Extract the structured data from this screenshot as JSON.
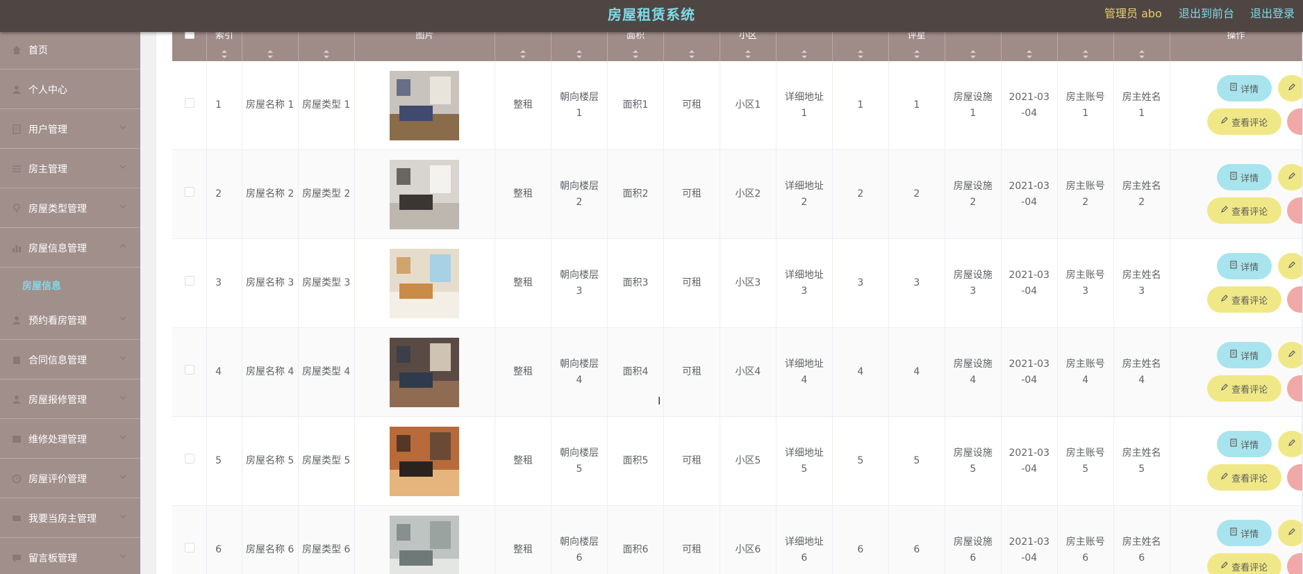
{
  "header": {
    "title": "房屋租赁系统",
    "admin": "管理员 abo",
    "back_to_front": "退出到前台",
    "logout": "退出登录"
  },
  "sidebar": {
    "items": [
      {
        "label": "首页",
        "icon": "home-icon"
      },
      {
        "label": "个人中心",
        "icon": "user-icon"
      },
      {
        "label": "用户管理",
        "icon": "document-icon"
      },
      {
        "label": "房主管理",
        "icon": "list-icon"
      },
      {
        "label": "房屋类型管理",
        "icon": "pin-icon"
      },
      {
        "label": "房屋信息管理",
        "icon": "chart-icon",
        "expanded": true
      },
      {
        "label": "预约看房管理",
        "icon": "user-icon"
      },
      {
        "label": "合同信息管理",
        "icon": "building-icon"
      },
      {
        "label": "房屋报修管理",
        "icon": "user-icon"
      },
      {
        "label": "维修处理管理",
        "icon": "grid-icon"
      },
      {
        "label": "房屋评价管理",
        "icon": "clock-icon"
      },
      {
        "label": "我要当房主管理",
        "icon": "keyboard-icon"
      },
      {
        "label": "留言板管理",
        "icon": "message-icon"
      }
    ],
    "submenu": {
      "label": "房屋信息"
    }
  },
  "table": {
    "header_labels": [
      "",
      "索引",
      "",
      "",
      "图片",
      "",
      "",
      "面积",
      "",
      "小区",
      "",
      "",
      "评星",
      "",
      "",
      "",
      "",
      "操作"
    ],
    "rows": [
      {
        "index": "1",
        "name": "房屋名称\n1",
        "type": "房屋类型\n1",
        "rent": "整租",
        "orient": "朝向楼层\n1",
        "area": "面积1",
        "status": "可租",
        "estate": "小区1",
        "addr": "详细地址\n1",
        "c11": "1",
        "c12": "1",
        "facility": "房屋设施\n1",
        "date": "2021-03\n-04",
        "account": "房主账号\n1",
        "owner": "房主姓名\n1"
      },
      {
        "index": "2",
        "name": "房屋名称\n2",
        "type": "房屋类型\n2",
        "rent": "整租",
        "orient": "朝向楼层\n2",
        "area": "面积2",
        "status": "可租",
        "estate": "小区2",
        "addr": "详细地址\n2",
        "c11": "2",
        "c12": "2",
        "facility": "房屋设施\n2",
        "date": "2021-03\n-04",
        "account": "房主账号\n2",
        "owner": "房主姓名\n2"
      },
      {
        "index": "3",
        "name": "房屋名称\n3",
        "type": "房屋类型\n3",
        "rent": "整租",
        "orient": "朝向楼层\n3",
        "area": "面积3",
        "status": "可租",
        "estate": "小区3",
        "addr": "详细地址\n3",
        "c11": "3",
        "c12": "3",
        "facility": "房屋设施\n3",
        "date": "2021-03\n-04",
        "account": "房主账号\n3",
        "owner": "房主姓名\n3"
      },
      {
        "index": "4",
        "name": "房屋名称\n4",
        "type": "房屋类型\n4",
        "rent": "整租",
        "orient": "朝向楼层\n4",
        "area": "面积4",
        "status": "可租",
        "estate": "小区4",
        "addr": "详细地址\n4",
        "c11": "4",
        "c12": "4",
        "facility": "房屋设施\n4",
        "date": "2021-03\n-04",
        "account": "房主账号\n4",
        "owner": "房主姓名\n4"
      },
      {
        "index": "5",
        "name": "房屋名称\n5",
        "type": "房屋类型\n5",
        "rent": "整租",
        "orient": "朝向楼层\n5",
        "area": "面积5",
        "status": "可租",
        "estate": "小区5",
        "addr": "详细地址\n5",
        "c11": "5",
        "c12": "5",
        "facility": "房屋设施\n5",
        "date": "2021-03\n-04",
        "account": "房主账号\n5",
        "owner": "房主姓名\n5"
      },
      {
        "index": "6",
        "name": "房屋名称\n6",
        "type": "房屋类型\n6",
        "rent": "整租",
        "orient": "朝向楼层\n6",
        "area": "面积6",
        "status": "可租",
        "estate": "小区6",
        "addr": "详细地址\n6",
        "c11": "6",
        "c12": "6",
        "facility": "房屋设施\n6",
        "date": "2021-03\n-04",
        "account": "房主账号\n6",
        "owner": "房主姓名\n6"
      }
    ],
    "buttons": {
      "detail": "详情",
      "review": "查看评论"
    }
  },
  "colors": {
    "topbar": "#4f4644",
    "sidebar": "#a18f8c",
    "accent": "#7fdbe6",
    "header_row": "#9f8b88",
    "detail_btn": "#a8e4ed",
    "review_btn": "#f0e887",
    "delete_btn": "#f0a9a6"
  }
}
